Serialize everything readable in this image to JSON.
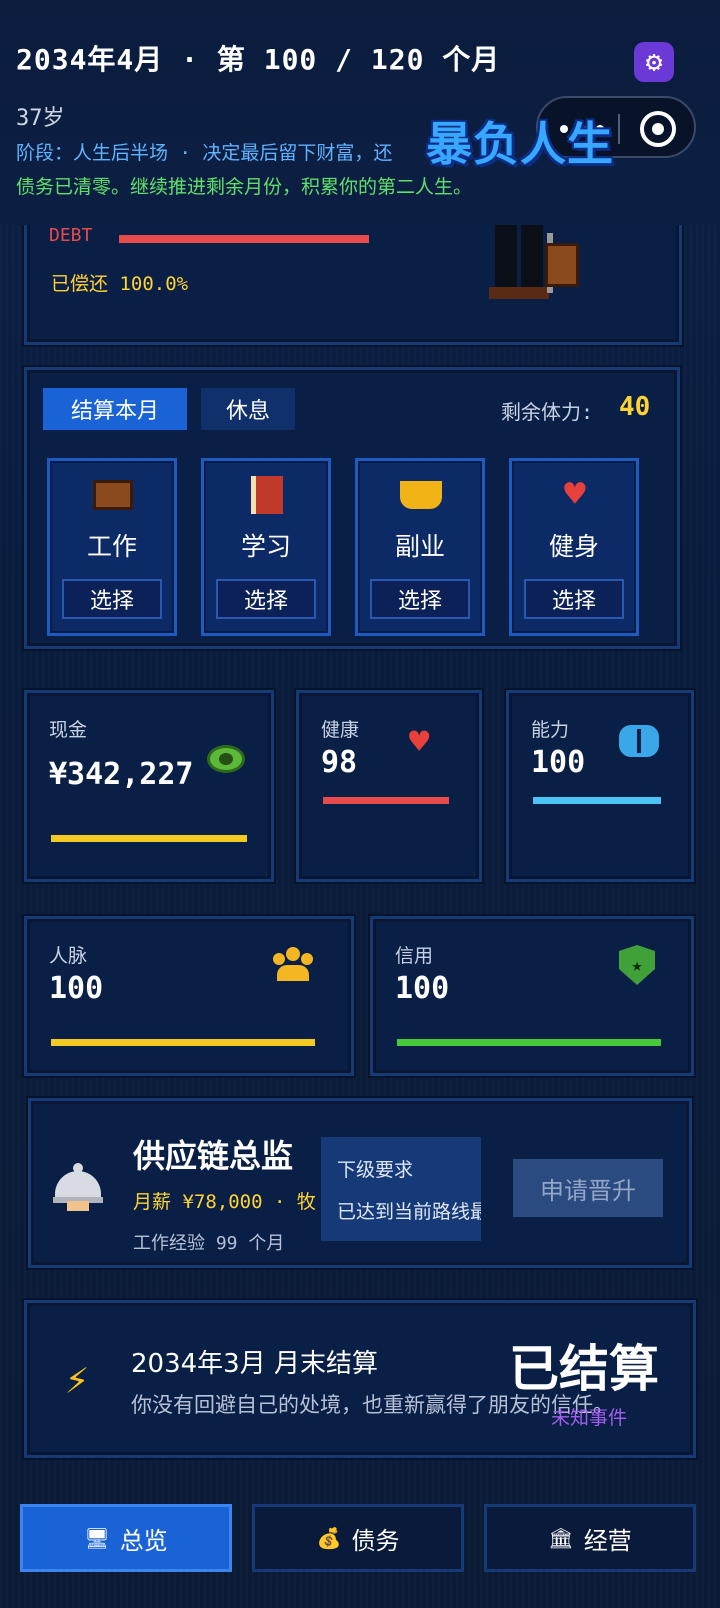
{
  "header": {
    "title": "2034年4月 · 第 100 / 120 个月",
    "age": "37岁",
    "stage": "阶段：人生后半场 · 决定最后留下财富，还",
    "debt_message": "债务已清零。继续推进剩余月份，积累你的第二人生。",
    "logo_text": "暴负人生",
    "settings_icon": "gear-icon"
  },
  "debt_panel": {
    "label": "DEBT",
    "repaid": "已偿还 100.0%",
    "bar_color": "#e84b4b"
  },
  "actions": {
    "settle_tab": "结算本月",
    "rest_tab": "休息",
    "stamina_label": "剩余体力:",
    "stamina_value": "40",
    "cards": [
      {
        "label": "工作",
        "icon": "briefcase-icon",
        "choose": "选择"
      },
      {
        "label": "学习",
        "icon": "book-icon",
        "choose": "选择"
      },
      {
        "label": "副业",
        "icon": "scooter-icon",
        "choose": "选择"
      },
      {
        "label": "健身",
        "icon": "heart-icon",
        "choose": "选择"
      }
    ]
  },
  "stats": {
    "cash": {
      "label": "现金",
      "value": "¥342,227",
      "color": "#f4c921"
    },
    "health": {
      "label": "健康",
      "value": "98",
      "color": "#e84b4b"
    },
    "ability": {
      "label": "能力",
      "value": "100",
      "color": "#4cc3f5"
    },
    "network": {
      "label": "人脉",
      "value": "100",
      "color": "#f4c921"
    },
    "credit": {
      "label": "信用",
      "value": "100",
      "color": "#45c93a"
    }
  },
  "career": {
    "title": "供应链总监",
    "salary": "月薪 ¥78,000 · 牧",
    "experience": "工作经验 99 个月",
    "tooltip_heading": "下级要求",
    "tooltip_text": "已达到当前路线最高",
    "promote_button": "申请晋升"
  },
  "event": {
    "title": "2034年3月 月末结算",
    "description": "你没有回避自己的处境，也重新赢得了朋友的信任。",
    "settled": "已结算",
    "unknown_event": "未知事件"
  },
  "nav": {
    "overview": "总览",
    "debt": "债务",
    "business": "经营"
  }
}
